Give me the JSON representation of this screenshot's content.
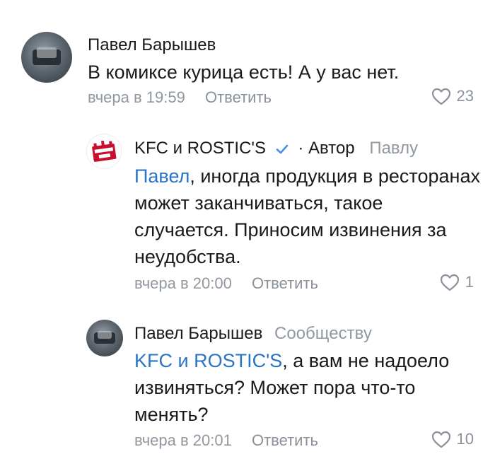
{
  "comments": [
    {
      "author": "Павел Барышев",
      "text": "В комиксе курица есть! А у вас нет.",
      "time": "вчера в 19:59",
      "reply_label": "Ответить",
      "likes": "23",
      "avatar_icon": "user-photo-icon"
    },
    {
      "author": "KFC и ROSTIC'S",
      "author_tag": "· Автор",
      "reply_to": "Павлу",
      "mention": "Павел",
      "text": ", иногда продукция в ресторанах может заканчиваться, такое случается. Приносим извинения за неудобства.",
      "time": "вчера в 20:00",
      "reply_label": "Ответить",
      "likes": "1",
      "avatar_icon": "kfc-rostics-logo-icon",
      "verified_icon": "verified-check-icon"
    },
    {
      "author": "Павел Барышев",
      "reply_to": "Сообществу",
      "mention": "KFC и ROSTIC'S",
      "text": ", а вам не надоело извиняться? Может пора что-то менять?",
      "time": "вчера в 20:01",
      "reply_label": "Ответить",
      "likes": "10",
      "avatar_icon": "user-photo-icon"
    }
  ],
  "colors": {
    "mention": "#2a73c7",
    "meta": "#9198a0",
    "verified": "#4a90e2",
    "kfc_red": "#c8102e"
  }
}
